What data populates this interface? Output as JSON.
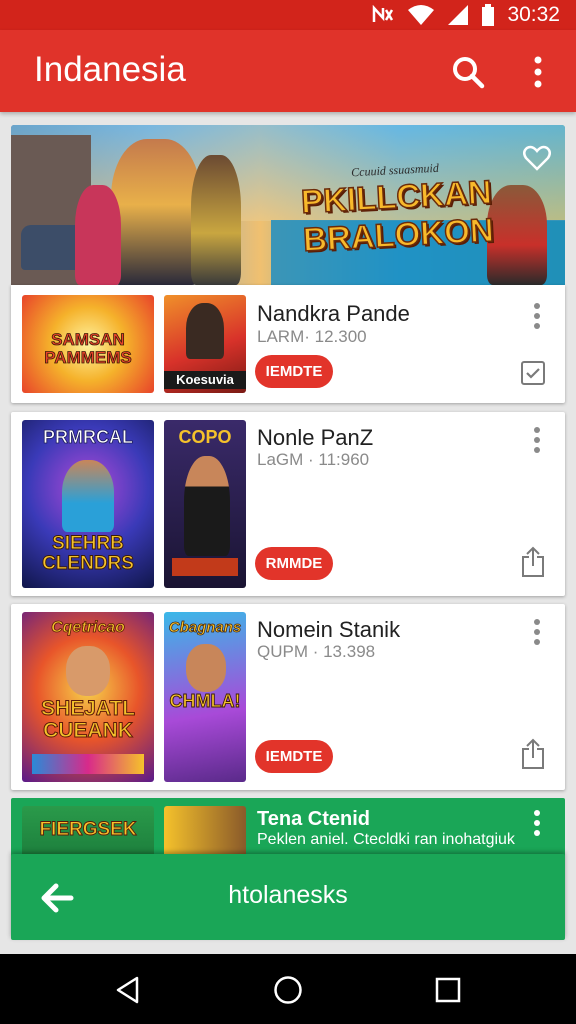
{
  "status_bar": {
    "time": "30:32",
    "icons": [
      "nfc-icon",
      "wifi-icon",
      "signal-icon",
      "battery-icon"
    ]
  },
  "app_bar": {
    "title": "Indanesia",
    "actions": [
      "search-icon",
      "overflow-menu-icon"
    ]
  },
  "hero": {
    "small_text": "Ccuuid ssuasmuid",
    "title_line1": "PKILLCKAN",
    "title_line2": "BRALOKON",
    "favorite_icon": "heart-outline-icon"
  },
  "cards": [
    {
      "thumb1_text": "SAMSAN PAMMEMS",
      "thumb2_text": "Koesuvia",
      "title": "Nandkra Pande",
      "subtitle": "LARM· 12.300",
      "button": "IEMDTE",
      "action_icon": "checkbox-icon"
    },
    {
      "thumb1_top": "PRMRCAL",
      "thumb1_text": "SIEHRB CLENDRS",
      "thumb2_top": "COPO",
      "title": "Nonle PanZ",
      "subtitle": "LaGM · 11:960",
      "button": "RMMDE",
      "action_icon": "share-icon"
    },
    {
      "thumb1_top": "Cqetricao",
      "thumb1_text": "SHEJATL CUEANK",
      "thumb2_top": "Cbagnans",
      "thumb2_text": "CHMLA!",
      "title": "Nomein Stanik",
      "subtitle": "QUPM · 13.398",
      "button": "IEMDTE",
      "action_icon": "share-icon"
    }
  ],
  "green_card": {
    "thumb_text": "FIERGSEK",
    "title": "Tena Ctenid",
    "description": "Peklen aniel. Ctecldki ran inohatgiuk"
  },
  "bottom_bar": {
    "label": "htolanesks",
    "back_icon": "back-arrow-icon"
  },
  "nav_bar": {
    "buttons": [
      "nav-back-icon",
      "nav-home-icon",
      "nav-recents-icon"
    ]
  },
  "colors": {
    "primary": "#e0332a",
    "status": "#d2241b",
    "accent_green": "#1aa657",
    "background": "#e6e6e6"
  }
}
